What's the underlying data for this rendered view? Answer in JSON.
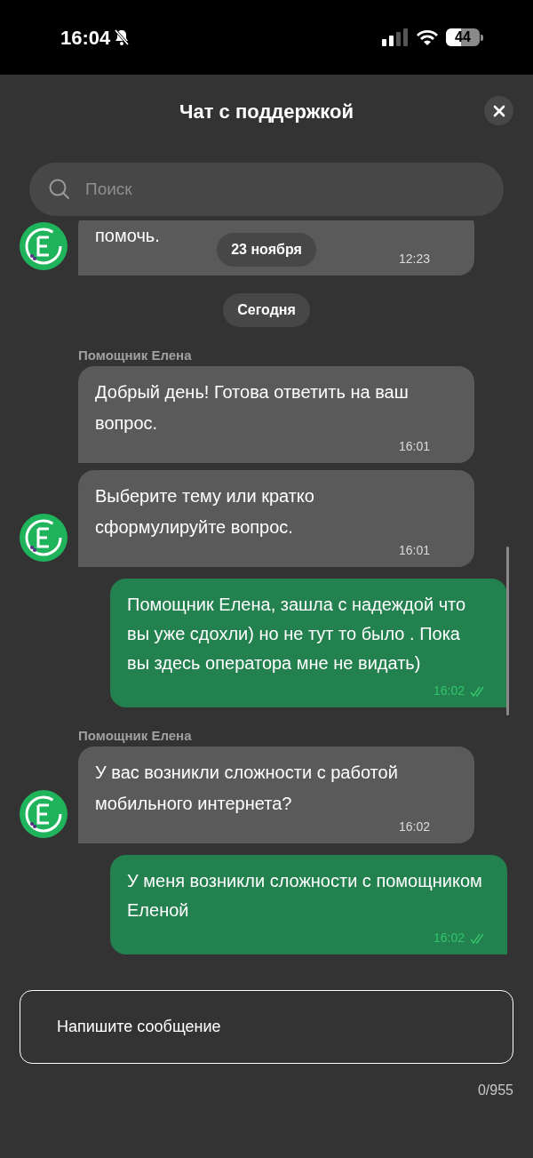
{
  "status_bar": {
    "time": "16:04",
    "battery": "44"
  },
  "header": {
    "title": "Чат с поддержкой"
  },
  "search": {
    "placeholder": "Поиск"
  },
  "messages": [
    {
      "kind": "incoming",
      "text": "помочь.",
      "time": "12:23",
      "avatar": true,
      "date_overlay": "23 ноября"
    },
    {
      "kind": "date",
      "text": "Сегодня"
    },
    {
      "kind": "sender",
      "text": "Помощник Елена"
    },
    {
      "kind": "incoming",
      "text": "Добрый день! Готова ответить на ваш вопрос.",
      "time": "16:01",
      "avatar": false
    },
    {
      "kind": "incoming",
      "text": "Выберите тему или кратко сформулируйте вопрос.",
      "time": "16:01",
      "avatar": true
    },
    {
      "kind": "outgoing",
      "text": "Помощник Елена, зашла с надеждой что вы уже сдохли) но не тут то было . Пока вы здесь оператора мне не видать)",
      "time": "16:02",
      "read": true
    },
    {
      "kind": "sender",
      "text": "Помощник Елена"
    },
    {
      "kind": "incoming",
      "text": "У вас возникли сложности с работой мобильного интернета?",
      "time": "16:02",
      "avatar": true
    },
    {
      "kind": "outgoing",
      "text": "У меня возникли сложности с помощником Еленой",
      "time": "16:02",
      "read": true
    }
  ],
  "composer": {
    "placeholder": "Напишите сообщение",
    "counter": "0/955"
  }
}
